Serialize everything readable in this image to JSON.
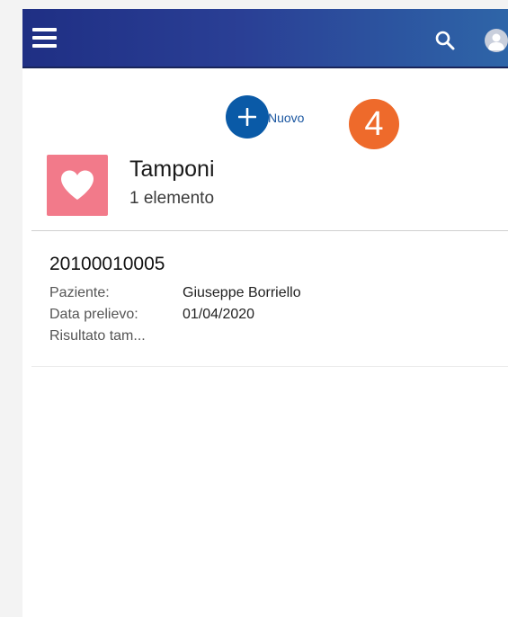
{
  "header": {
    "menu_icon": "hamburger-menu-icon",
    "search_icon": "search-icon",
    "avatar_icon": "user-avatar-icon",
    "gradient_start": "#1f2f84",
    "gradient_end": "#2e65a8"
  },
  "new_action": {
    "label": "Nuovo",
    "icon": "plus-icon",
    "color": "#0a5aa7"
  },
  "step_badge": {
    "number": "4",
    "color": "#ee6a2b"
  },
  "object": {
    "title": "Tamponi",
    "count_text": "1 elemento",
    "icon": "heart-icon",
    "icon_color": "#f27a8a"
  },
  "records": [
    {
      "id": "20100010005",
      "fields": [
        {
          "label": "Paziente:",
          "value": "Giuseppe Borriello"
        },
        {
          "label": "Data prelievo:",
          "value": "01/04/2020"
        },
        {
          "label": "Risultato tam...",
          "value": ""
        }
      ]
    }
  ]
}
